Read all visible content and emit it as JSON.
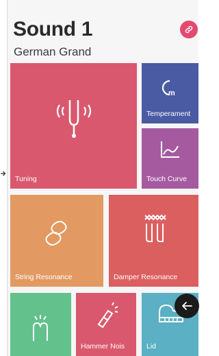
{
  "header": {
    "title": "Sound 1",
    "subtitle": "German Grand",
    "link_icon": "link-icon"
  },
  "tiles": [
    {
      "label": "Tuning",
      "color": "#d9586e",
      "icon": "tuning-fork-icon"
    },
    {
      "label": "Temperament",
      "color": "#4a5aa3",
      "icon": "temperament-icon"
    },
    {
      "label": "Touch Curve",
      "color": "#a55aa0",
      "icon": "chart-curve-icon"
    },
    {
      "label": "String Resonance",
      "color": "#e39a62",
      "icon": "string-icon"
    },
    {
      "label": "Damper Resonance",
      "color": "#dc5f5f",
      "icon": "damper-icon"
    },
    {
      "label": "",
      "color": "#63c18c",
      "icon": "hammer-strike-icon"
    },
    {
      "label": "Hammer Nois",
      "color": "#d9586e",
      "icon": "hammer-icon"
    },
    {
      "label": "Lid",
      "color": "#5bb0c3",
      "icon": "piano-lid-icon"
    }
  ],
  "colors": {
    "accent": "#e34a6f",
    "fab": "#1b1b1b"
  },
  "fab": {
    "icon": "arrow-left-icon"
  },
  "side_handle": {
    "icon": "arrow-right-icon"
  }
}
